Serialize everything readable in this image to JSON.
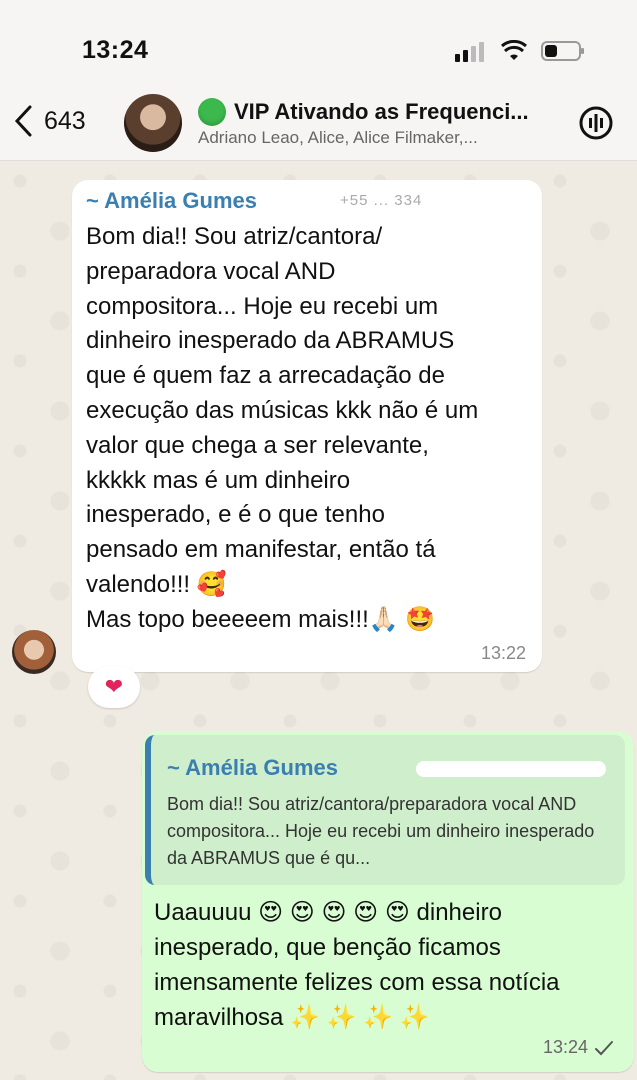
{
  "status": {
    "time": "13:24"
  },
  "header": {
    "back_count": "643",
    "title": "VIP Ativando as Frequenci...",
    "members": "Adriano Leao, Alice, Alice Filmaker,..."
  },
  "messages": {
    "incoming": {
      "sender": "~ Amélia Gumes",
      "sender_phone": "+55 ... 334",
      "text": "Bom dia!! Sou atriz/cantora/\npreparadora vocal AND\ncompositora... Hoje eu recebi um\ndinheiro inesperado da ABRAMUS\nque é quem faz a arrecadação de\nexecução das músicas kkk não é um\nvalor que chega a ser relevante,\nkkkkk mas é um dinheiro\ninesperado, e é o que tenho\npensado em manifestar, então tá\nvalendo!!! 🥰\nMas topo beeeeem mais!!!🙏🏻 🤩",
      "time": "13:22",
      "reaction": "❤"
    },
    "outgoing": {
      "quote_sender": "~ Amélia Gumes",
      "quote_text": "Bom dia!! Sou atriz/cantora/preparadora vocal AND compositora... Hoje eu recebi um dinheiro inesperado da ABRAMUS que é qu...",
      "text": "Uaauuuu 😍 😍 😍 😍 😍 dinheiro inesperado, que benção ficamos imensamente felizes com essa notícia maravilhosa ✨ ✨ ✨ ✨",
      "time": "13:24",
      "status_icon": "check-icon"
    }
  }
}
